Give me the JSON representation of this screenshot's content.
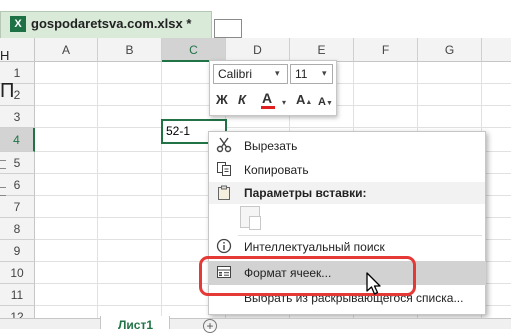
{
  "file_tab": {
    "name": "gospodaretsva.com.xlsx *"
  },
  "columns": [
    "A",
    "B",
    "C",
    "D",
    "E",
    "F",
    "G"
  ],
  "rows": [
    "1",
    "2",
    "3",
    "4",
    "5",
    "6",
    "7",
    "8",
    "9",
    "10",
    "11",
    "12"
  ],
  "selected_column": "C",
  "selected_row": "4",
  "active_cell": {
    "ref": "C4",
    "value": "52-1"
  },
  "edge_text": {
    "top": "Н",
    "large": "П"
  },
  "mini_toolbar": {
    "font_name": "Calibri",
    "font_size": "11",
    "bold": "Ж",
    "italic": "К",
    "font_color": "А",
    "grow_font": "А",
    "shrink_font": "А",
    "dropdown_glyph": "▾",
    "font_color_bar": "#e02020"
  },
  "context_menu": {
    "cut": "Вырезать",
    "copy": "Копировать",
    "paste_options_header": "Параметры вставки:",
    "smart_lookup": "Интеллектуальный поиск",
    "format_cells": "Формат ячеек...",
    "pick_from_list": "Выбрать из раскрывающегося списка..."
  },
  "icons": {
    "file": "excel-file-icon",
    "cut": "scissors-icon",
    "copy": "copy-icon",
    "paste": "clipboard-icon",
    "lookup": "info-icon",
    "format": "format-cells-icon",
    "cursor": "mouse-pointer-icon",
    "add_sheet": "plus-icon"
  },
  "sheet_tabs": {
    "active": "Лист1",
    "add": "+"
  },
  "colors": {
    "accent": "#217346",
    "highlight_box": "#e53935",
    "file_tab_bg": "#d9ead9"
  }
}
